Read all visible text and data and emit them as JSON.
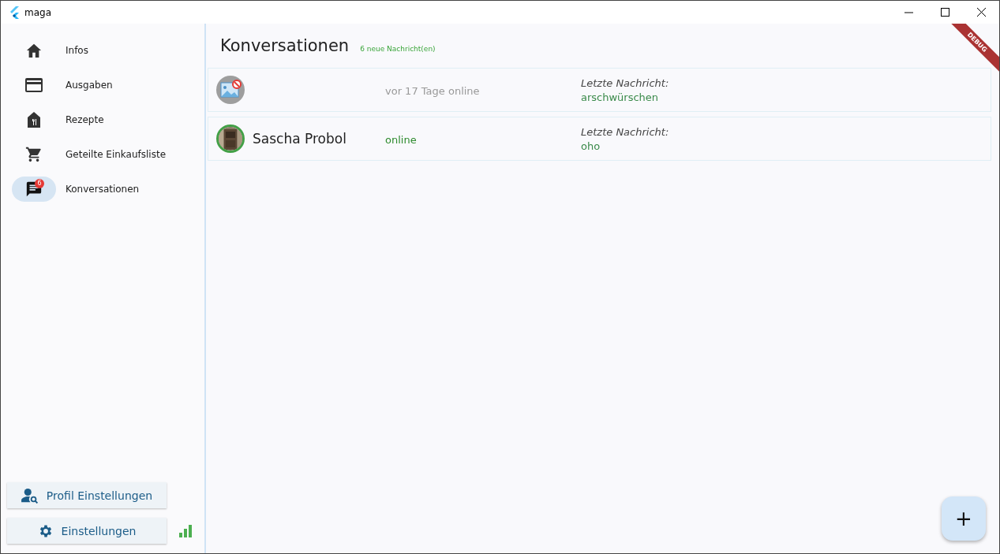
{
  "window": {
    "title": "maga"
  },
  "sidebar": {
    "items": [
      {
        "label": "Infos",
        "selected": false
      },
      {
        "label": "Ausgaben",
        "selected": false
      },
      {
        "label": "Rezepte",
        "selected": false
      },
      {
        "label": "Geteilte Einkaufsliste",
        "selected": false
      },
      {
        "label": "Konversationen",
        "selected": true,
        "badge": "6"
      }
    ],
    "buttons": [
      {
        "label": "Profil Einstellungen"
      },
      {
        "label": "Einstellungen"
      }
    ]
  },
  "main": {
    "title": "Konversationen",
    "subtitle": "6 neue Nachricht(en)",
    "debug_banner": "DEBUG",
    "conversations": [
      {
        "kind": "placeholder",
        "online": false,
        "status": "vor 17 Tage online",
        "last_label": "Letzte Nachricht:",
        "last_message": "arschwürschen"
      },
      {
        "kind": "picture",
        "online": true,
        "name": "Sascha Probol",
        "status": "online",
        "last_label": "Letzte Nachricht:",
        "last_message": "oho"
      }
    ],
    "fab": "+"
  }
}
